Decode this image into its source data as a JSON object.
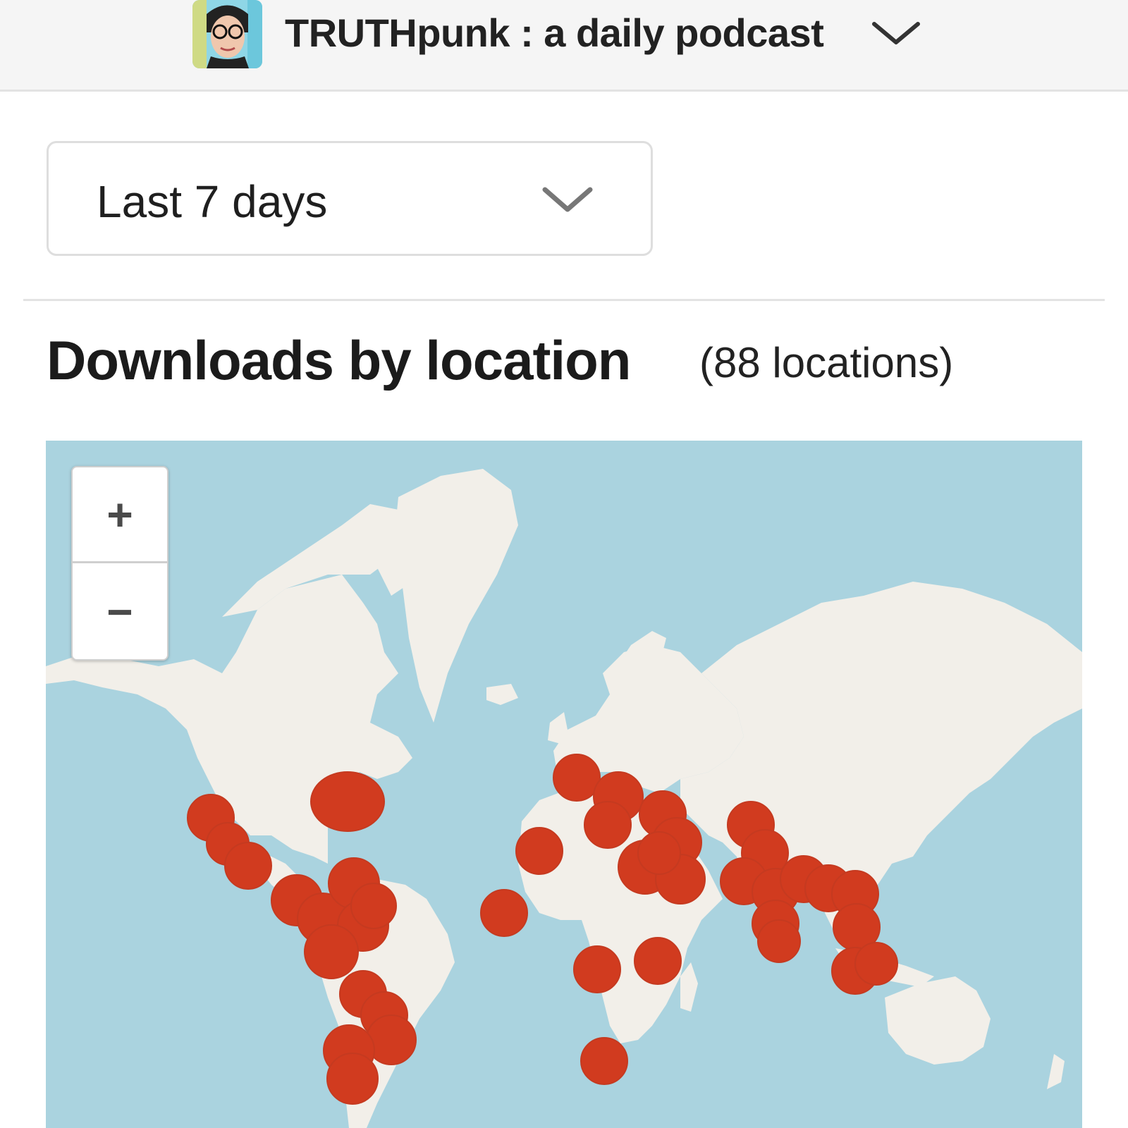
{
  "header": {
    "podcast_title": "TRUTHpunk : a daily podcast",
    "avatar_icon": "podcast-avatar",
    "dropdown_icon": "chevron-down-icon"
  },
  "filter": {
    "range_label": "Last 7 days",
    "dropdown_icon": "chevron-down-icon"
  },
  "section": {
    "title": "Downloads by location",
    "count": "(88 locations)"
  },
  "map": {
    "zoom_in_label": "+",
    "zoom_out_label": "−",
    "colors": {
      "water": "#aad3df",
      "land": "#f2efe9",
      "marker": "#d13b1f"
    }
  }
}
